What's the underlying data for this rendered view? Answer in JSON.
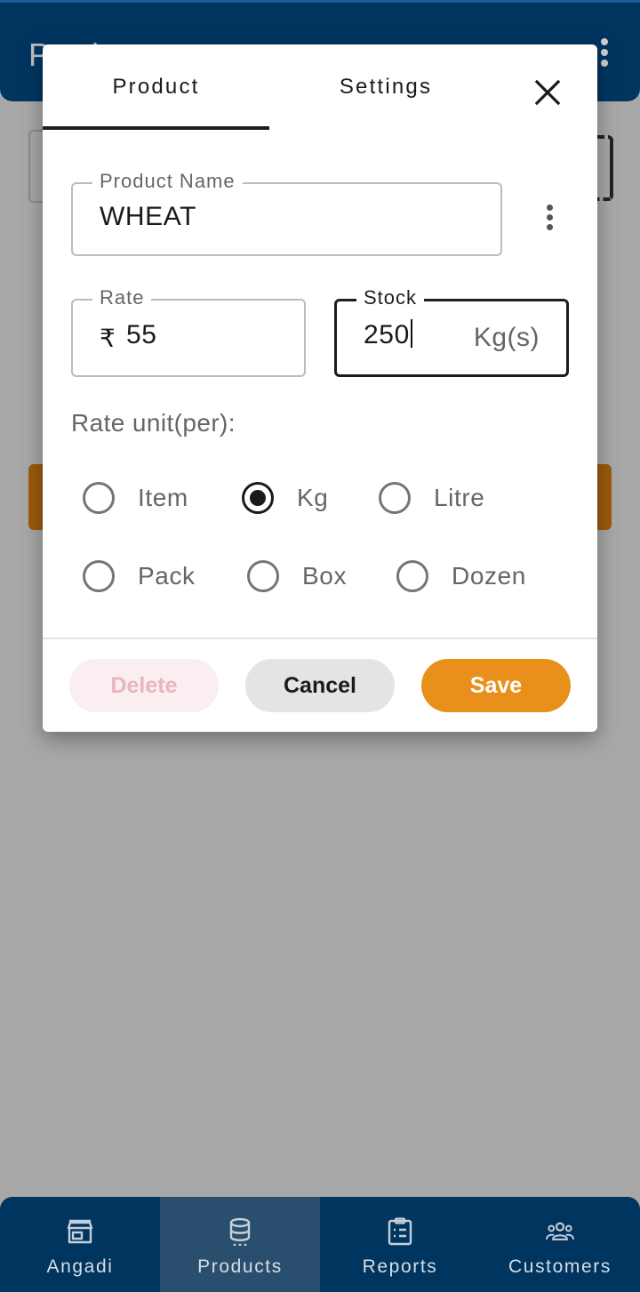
{
  "app": {
    "title": "Product",
    "menu_icon": "more-vert-icon"
  },
  "dialog": {
    "tabs": [
      {
        "label": "Product",
        "active": true
      },
      {
        "label": "Settings",
        "active": false
      }
    ],
    "close_icon": "close-icon",
    "product_name": {
      "label": "Product Name",
      "value": "WHEAT"
    },
    "rate": {
      "label": "Rate",
      "currency": "₹",
      "value": "55"
    },
    "stock": {
      "label": "Stock",
      "value": "250",
      "unit": "Kg(s)"
    },
    "rate_unit": {
      "label": "Rate unit(per):",
      "options": [
        {
          "label": "Item",
          "checked": false
        },
        {
          "label": "Kg",
          "checked": true
        },
        {
          "label": "Litre",
          "checked": false
        },
        {
          "label": "Pack",
          "checked": false
        },
        {
          "label": "Box",
          "checked": false
        },
        {
          "label": "Dozen",
          "checked": false
        }
      ]
    },
    "buttons": {
      "delete": "Delete",
      "cancel": "Cancel",
      "save": "Save"
    }
  },
  "bottom_nav": [
    {
      "label": "Angadi",
      "icon": "store-icon",
      "active": false
    },
    {
      "label": "Products",
      "icon": "database-icon",
      "active": true
    },
    {
      "label": "Reports",
      "icon": "clipboard-list-icon",
      "active": false
    },
    {
      "label": "Customers",
      "icon": "group-icon",
      "active": false
    }
  ],
  "colors": {
    "app_bar": "#003560",
    "save": "#e9901c",
    "active_nav": "#2a4e6e"
  }
}
